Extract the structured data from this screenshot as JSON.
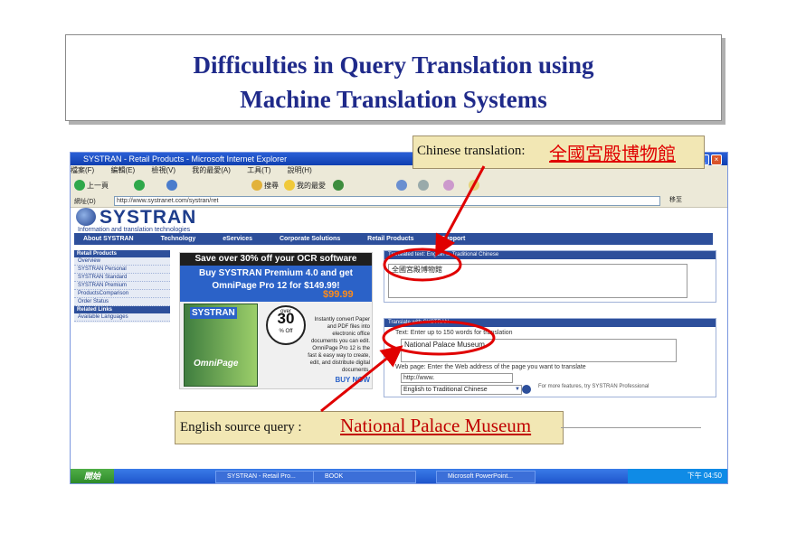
{
  "slide": {
    "title_line1": "Difficulties in Query Translation using",
    "title_line2": "Machine Translation Systems"
  },
  "browser": {
    "window_title": "SYSTRAN - Retail Products - Microsoft Internet Explorer",
    "menu": [
      "檔案(F)",
      "編輯(E)",
      "檢視(V)",
      "我的最愛(A)",
      "工具(T)",
      "說明(H)"
    ],
    "toolbar": {
      "back": "上一頁",
      "search": "搜尋",
      "favorites": "我的最愛"
    },
    "address_label": "網址(D)",
    "address_value": "http://www.systranet.com/systran/ret",
    "go_label": "移至"
  },
  "systran": {
    "logo": "SYSTRAN",
    "tagline": "Information and translation technologies",
    "nav": [
      "About SYSTRAN",
      "Technology",
      "eServices",
      "Corporate Solutions",
      "Retail Products",
      "Support"
    ],
    "sidebar_head": "Retail Products",
    "sidebar_items": [
      "Overview",
      "SYSTRAN Personal",
      "SYSTRAN Standard",
      "SYSTRAN Premium",
      "ProductsComparison",
      "Order Status"
    ],
    "sidebar_head2": "Related Links",
    "sidebar_items2": [
      "Available Languages"
    ]
  },
  "ad": {
    "top": "Save over 30% off your OCR software",
    "head1": "Buy SYSTRAN Premium 4.0 and get",
    "head2": "OmniPage Pro 12 for $149.99!",
    "price_old": "$149.99!",
    "price_new": "$99.99",
    "box_label": "SYSTRAN",
    "box_label2": "OmniPage",
    "badge_over": "over",
    "badge_num": "30",
    "badge_off": "% Off",
    "copy": "Instantly convert Paper and PDF files into electronic office documents you can edit. OmniPage Pro 12 is the fast & easy way to create, edit, and distribute digital documents.",
    "buy": "BUY NOW"
  },
  "translation": {
    "output_head": "Translated text: English to Traditional Chinese",
    "output_text": "全國宮殿博物館",
    "input_head": "Translate with SYSTRAN",
    "input_prompt": "Text: Enter up to 150 words for translation",
    "input_text": "National Palace Museum",
    "web_prompt": "Web page: Enter the Web address of the page you want to translate",
    "url_value": "http://www.",
    "language": "English to Traditional Chinese",
    "note": "For more features, try SYSTRAN Professional"
  },
  "taskbar": {
    "start": "開始",
    "tasks": [
      "SYSTRAN - Retail Pro...",
      "BOOK",
      "Microsoft PowerPoint..."
    ],
    "clock": "下午 04:50"
  },
  "callouts": {
    "chinese_label": "Chinese translation:",
    "chinese_value": "全國宮殿博物館",
    "english_label": "English source query :",
    "english_value": "National Palace Museum"
  }
}
